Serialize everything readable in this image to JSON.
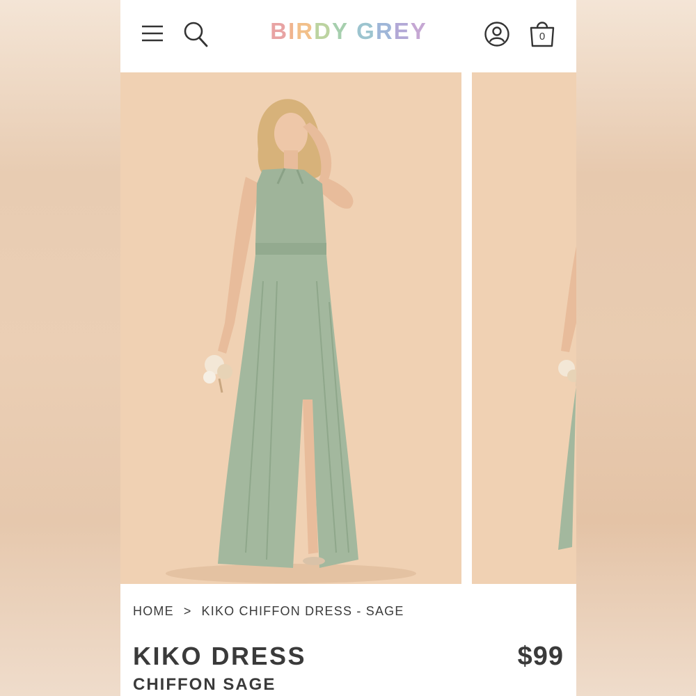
{
  "header": {
    "logo_letters": [
      {
        "ch": "B",
        "color": "#e8a3a3"
      },
      {
        "ch": "I",
        "color": "#f0b48e"
      },
      {
        "ch": "R",
        "color": "#f2c08a"
      },
      {
        "ch": "D",
        "color": "#bcd3a0"
      },
      {
        "ch": "Y",
        "color": "#a6cfae"
      },
      {
        "ch": " ",
        "color": "#ffffff"
      },
      {
        "ch": "G",
        "color": "#9cc4cf"
      },
      {
        "ch": "R",
        "color": "#9fb6d8"
      },
      {
        "ch": "E",
        "color": "#b2a8d6"
      },
      {
        "ch": "Y",
        "color": "#c5a7d3"
      }
    ],
    "bag_count": "0",
    "icons": {
      "menu": "hamburger-menu-icon",
      "search": "search-icon",
      "account": "user-account-icon",
      "bag": "shopping-bag-icon"
    }
  },
  "gallery": {
    "slides": [
      "Model wearing sage halter chiffon gown",
      "Second view partially visible"
    ],
    "colors": {
      "backdrop": "#f0d1b3",
      "dress": "#9fb49a",
      "dress_shadow": "#879f84"
    }
  },
  "breadcrumb": {
    "home": "HOME",
    "separator": ">",
    "current": "KIKO CHIFFON DRESS - SAGE"
  },
  "product": {
    "title": "KIKO DRESS",
    "subtitle": "CHIFFON SAGE",
    "price": "$99"
  }
}
